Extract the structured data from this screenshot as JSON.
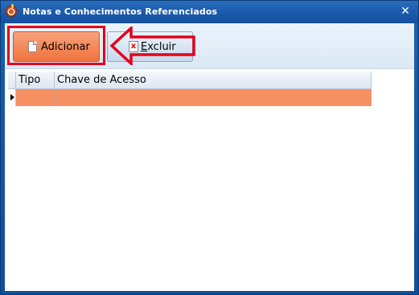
{
  "window": {
    "title": "Notas e Conhecimentos Referenciados",
    "close_glyph": "✕"
  },
  "toolbar": {
    "add_label": "Adicionar",
    "delete_label_first": "E",
    "delete_label_rest": "xcluir"
  },
  "grid": {
    "columns": [
      "Tipo",
      "Chave de Acesso"
    ],
    "rows": [
      {
        "tipo": "",
        "chave": ""
      }
    ]
  },
  "colors": {
    "title_bar": "#1a5aaa",
    "add_button": "#f58a5b",
    "selected_row": "#f68f62",
    "annotation_red": "#e3001b"
  },
  "icons": {
    "app": "app-logo-icon",
    "add": "new-document-icon",
    "delete": "delete-document-icon",
    "close": "close-icon"
  }
}
